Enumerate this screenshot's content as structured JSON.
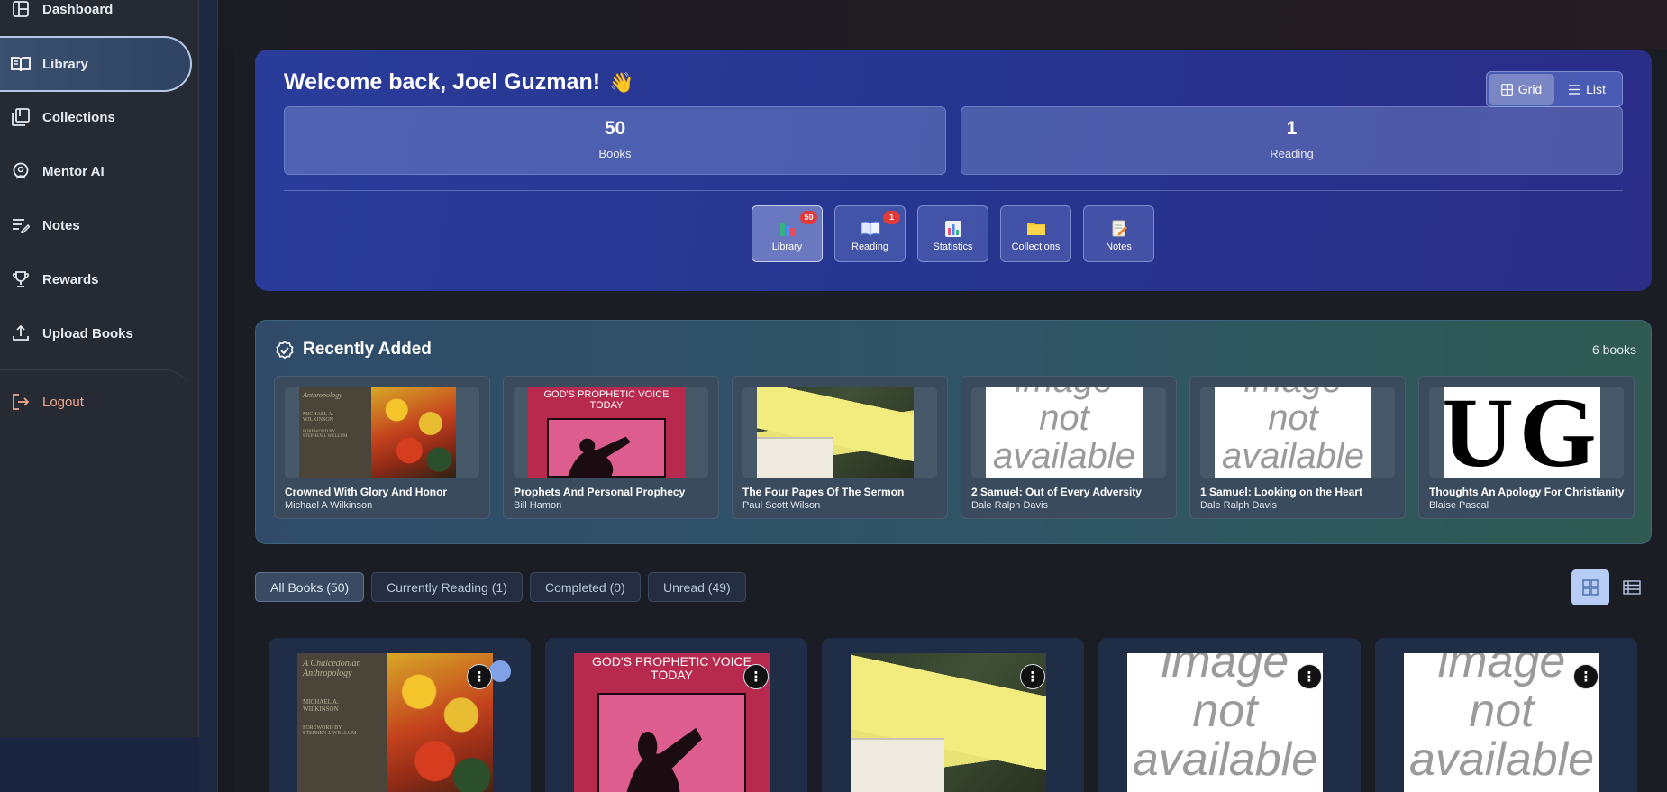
{
  "sidebar": {
    "items": [
      {
        "label": "Dashboard",
        "icon": "dashboard-icon"
      },
      {
        "label": "Library",
        "icon": "book-open-icon",
        "active": true
      },
      {
        "label": "Collections",
        "icon": "collections-icon"
      },
      {
        "label": "Mentor AI",
        "icon": "mentor-ai-icon"
      },
      {
        "label": "Notes",
        "icon": "notes-icon"
      },
      {
        "label": "Rewards",
        "icon": "trophy-icon"
      },
      {
        "label": "Upload Books",
        "icon": "upload-icon"
      }
    ],
    "logout_label": "Logout"
  },
  "hero": {
    "greeting": "Welcome back, Joel Guzman!",
    "wave": "👋",
    "view_toggle": {
      "grid_label": "Grid",
      "list_label": "List",
      "selected": "Grid"
    },
    "stats": [
      {
        "value": "50",
        "label": "Books"
      },
      {
        "value": "1",
        "label": "Reading"
      }
    ],
    "quick_actions": [
      {
        "label": "Library",
        "badge": "50",
        "icon": "library-books-icon"
      },
      {
        "label": "Reading",
        "badge": "1",
        "icon": "open-book-icon"
      },
      {
        "label": "Statistics",
        "badge": "",
        "icon": "bar-chart-icon"
      },
      {
        "label": "Collections",
        "badge": "",
        "icon": "folder-icon"
      },
      {
        "label": "Notes",
        "badge": "",
        "icon": "memo-icon"
      }
    ]
  },
  "recent": {
    "title": "Recently Added",
    "count": "6 books",
    "books": [
      {
        "title": "Crowned With Glory And Honor",
        "author": "Michael A Wilkinson",
        "cover": "anthropology"
      },
      {
        "title": "Prophets And Personal Prophecy",
        "author": "Bill Hamon",
        "cover": "prophetic"
      },
      {
        "title": "The Four Pages Of The Sermon",
        "author": "Paul Scott Wilson",
        "cover": "sermon"
      },
      {
        "title": "2 Samuel: Out of Every Adversity",
        "author": "Dale Ralph Davis",
        "cover": "not-available"
      },
      {
        "title": "1 Samuel: Looking on the Heart",
        "author": "Dale Ralph Davis",
        "cover": "not-available"
      },
      {
        "title": "Thoughts An Apology For Christianity",
        "author": "Blaise Pascal",
        "cover": "ug"
      }
    ]
  },
  "covers": {
    "anthro_lines": [
      "Anthropology",
      "MICHAEL A.",
      "WILKINSON",
      "FOREWORD BY",
      "STEPHEN J. WELLUM"
    ],
    "anthro_title_grid": [
      "A Chalcedonian",
      "Anthropology"
    ],
    "prophet_title": "GOD'S PROPHETIC VOICE TODAY",
    "na_lines": [
      "image",
      "not",
      "available"
    ],
    "ug_text": "UG"
  },
  "filters": [
    {
      "label": "All Books (50)",
      "active": true
    },
    {
      "label": "Currently Reading (1)",
      "active": false
    },
    {
      "label": "Completed (0)",
      "active": false
    },
    {
      "label": "Unread (49)",
      "active": false
    }
  ],
  "grid": {
    "menu_glyph": "⋮",
    "books": [
      {
        "cover": "anthropology"
      },
      {
        "cover": "prophetic"
      },
      {
        "cover": "sermon"
      },
      {
        "cover": "not-available"
      },
      {
        "cover": "not-available"
      }
    ]
  },
  "colors": {
    "accent": "#2a3c9a",
    "badge": "#e23a3a",
    "logout": "#f2a88e"
  }
}
